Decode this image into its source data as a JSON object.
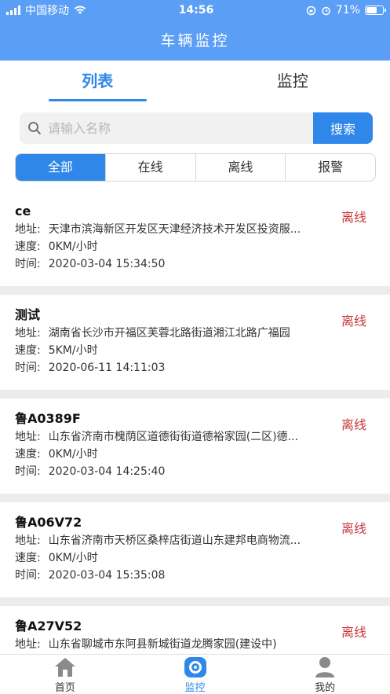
{
  "status_bar": {
    "carrier": "中国移动",
    "time": "14:56",
    "battery": "71%",
    "battery_level": 0.71
  },
  "header": {
    "title": "车辆监控"
  },
  "tabs": [
    {
      "label": "列表",
      "active": true
    },
    {
      "label": "监控",
      "active": false
    }
  ],
  "search": {
    "placeholder": "请输入名称",
    "button_label": "搜索"
  },
  "filters": [
    {
      "label": "全部",
      "active": true
    },
    {
      "label": "在线",
      "active": false
    },
    {
      "label": "离线",
      "active": false
    },
    {
      "label": "报警",
      "active": false
    }
  ],
  "labels": {
    "address": "地址:",
    "speed": "速度:",
    "time": "时间:"
  },
  "vehicles": [
    {
      "name": "ce",
      "status": "离线",
      "address": "天津市滨海新区开发区天津经济技术开发区投资服...",
      "speed": "0KM/小时",
      "time": "2020-03-04 15:34:50"
    },
    {
      "name": "测试",
      "status": "离线",
      "address": "湖南省长沙市开福区芙蓉北路街道湘江北路广福园",
      "speed": "5KM/小时",
      "time": "2020-06-11 14:11:03"
    },
    {
      "name": "鲁A0389F",
      "status": "离线",
      "address": "山东省济南市槐荫区道德街街道德裕家园(二区)德...",
      "speed": "0KM/小时",
      "time": "2020-03-04 14:25:40"
    },
    {
      "name": "鲁A06V72",
      "status": "离线",
      "address": "山东省济南市天桥区桑梓店街道山东建邦电商物流...",
      "speed": "0KM/小时",
      "time": "2020-03-04 15:35:08"
    },
    {
      "name": "鲁A27V52",
      "status": "离线",
      "address": "山东省聊城市东阿县新城街道龙腾家园(建设中)",
      "speed": "",
      "time": ""
    }
  ],
  "bottom_nav": [
    {
      "label": "首页",
      "icon": "home-icon",
      "active": false
    },
    {
      "label": "监控",
      "icon": "monitor-camera-icon",
      "active": true
    },
    {
      "label": "我的",
      "icon": "user-icon",
      "active": false
    }
  ],
  "colors": {
    "header": "#5a9ef5",
    "accent": "#2f87ea",
    "offline": "#c6353a",
    "background": "#ececec"
  }
}
